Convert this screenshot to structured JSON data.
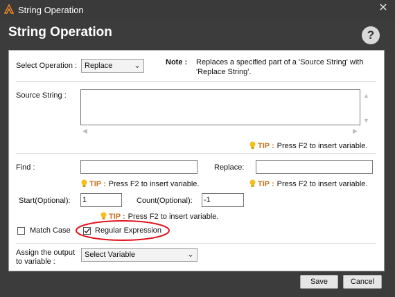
{
  "window": {
    "title": "String Operation",
    "close_glyph": "✕"
  },
  "header": {
    "title": "String Operation",
    "help_glyph": "?"
  },
  "operation": {
    "label": "Select Operation :",
    "value": "Replace",
    "note_label": "Note :",
    "note_text_line1": "Replaces a specified part of a 'Source String' with",
    "note_text_line2": "'Replace String'."
  },
  "source": {
    "label": "Source String :",
    "value": ""
  },
  "tip": {
    "key": "TIP :",
    "text": "Press F2 to insert variable."
  },
  "find": {
    "label": "Find :",
    "value": ""
  },
  "replace": {
    "label": "Replace:",
    "value": ""
  },
  "start": {
    "label": "Start(Optional):",
    "value": "1"
  },
  "count": {
    "label": "Count(Optional):",
    "value": "-1"
  },
  "match_case": {
    "label": "Match Case",
    "checked": false
  },
  "regex": {
    "label": "Regular Expression",
    "checked": true
  },
  "assign": {
    "label_line1": "Assign the output",
    "label_line2": "to variable :",
    "value": "Select Variable"
  },
  "footer": {
    "save_label": "Save",
    "cancel_label": "Cancel"
  },
  "colors": {
    "tip_key": "#c8741d",
    "bulb": "#f2c21b",
    "annotation": "#e0141e"
  }
}
